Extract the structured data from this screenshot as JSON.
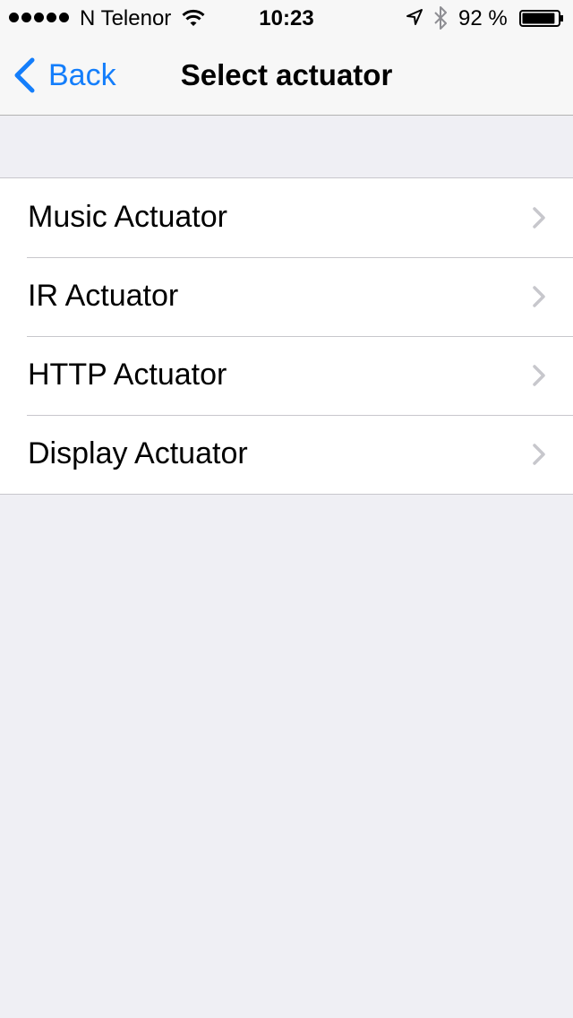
{
  "status_bar": {
    "carrier": "N Telenor",
    "time": "10:23",
    "battery_percent": "92 %",
    "battery_level": 0.92,
    "icons": [
      "signal-dots-icon",
      "wifi-icon",
      "location-arrow-icon",
      "bluetooth-icon",
      "battery-icon"
    ]
  },
  "nav": {
    "back_label": "Back",
    "title": "Select actuator"
  },
  "list": {
    "items": [
      {
        "label": "Music Actuator"
      },
      {
        "label": "IR Actuator"
      },
      {
        "label": "HTTP Actuator"
      },
      {
        "label": "Display Actuator"
      }
    ]
  },
  "colors": {
    "accent": "#147efb",
    "background": "#efeff4",
    "separator": "#c8c7cc",
    "chevron": "#c7c7cc"
  }
}
